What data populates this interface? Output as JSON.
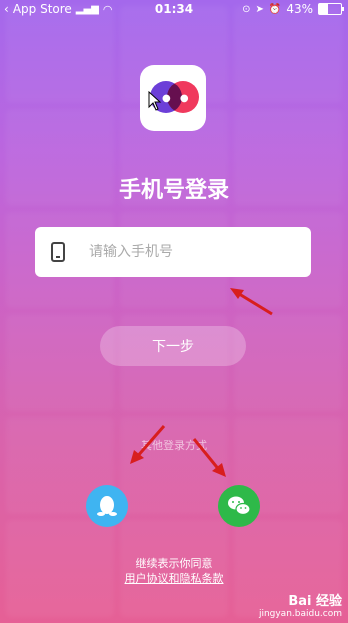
{
  "status_bar": {
    "back_app": "App Store",
    "time": "01:34",
    "battery": "43%",
    "battery_level": 0.43
  },
  "login": {
    "title": "手机号登录",
    "phone_placeholder": "请输入手机号",
    "next_label": "下一步",
    "other_methods": "其他登录方式",
    "agree_text": "继续表示你同意",
    "terms_link": "用户协议和隐私条款"
  },
  "watermark": {
    "brand": "Bai 经验",
    "url": "jingyan.baidu.com"
  },
  "colors": {
    "qq": "#3fb4f1",
    "wechat": "#2eb949",
    "arrow": "#d81e1e"
  }
}
